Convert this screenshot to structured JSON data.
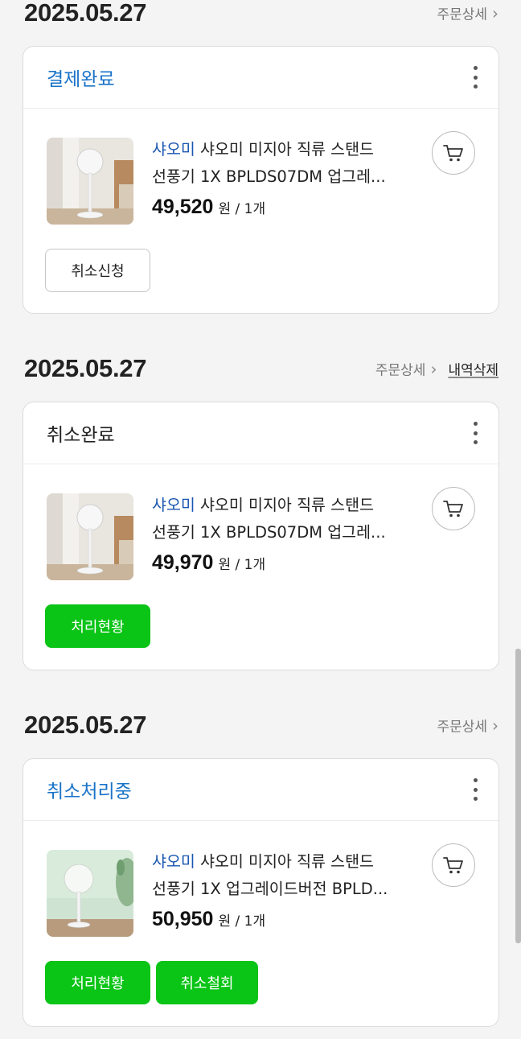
{
  "orders": [
    {
      "date": "2025.05.27",
      "detail_label": "주문상세",
      "delete_label": "",
      "status": "결제완료",
      "status_color": "#1a73c8",
      "item": {
        "brand": "샤오미",
        "name_line1": "샤오미 미지아 직류 스탠드",
        "name_line2": "선풍기 1X BPLDS07DM 업그레...",
        "price": "49,520",
        "unit": "원 / 1개"
      },
      "buttons": [
        "취소신청"
      ]
    },
    {
      "date": "2025.05.27",
      "detail_label": "주문상세",
      "delete_label": "내역삭제",
      "status": "취소완료",
      "status_color": "#222222",
      "item": {
        "brand": "샤오미",
        "name_line1": "샤오미 미지아 직류 스탠드",
        "name_line2": "선풍기 1X BPLDS07DM 업그레...",
        "price": "49,970",
        "unit": "원 / 1개"
      },
      "buttons": [
        "처리현황"
      ]
    },
    {
      "date": "2025.05.27",
      "detail_label": "주문상세",
      "delete_label": "",
      "status": "취소처리중",
      "status_color": "#1a73c8",
      "item": {
        "brand": "샤오미",
        "name_line1": "샤오미 미지아 직류 스탠드",
        "name_line2": "선풍기 1X 업그레이드버전 BPLD...",
        "price": "50,950",
        "unit": "원 / 1개"
      },
      "buttons": [
        "처리현황",
        "취소철회"
      ]
    }
  ],
  "colors": {
    "accent_blue": "#1a73c8",
    "brand_blue": "#1a56b0",
    "action_green": "#0ac416",
    "background": "#f4f4f4"
  },
  "icons": {
    "detail_chevron": "chevron-right-icon",
    "more": "more-vertical-icon",
    "cart": "cart-icon"
  }
}
